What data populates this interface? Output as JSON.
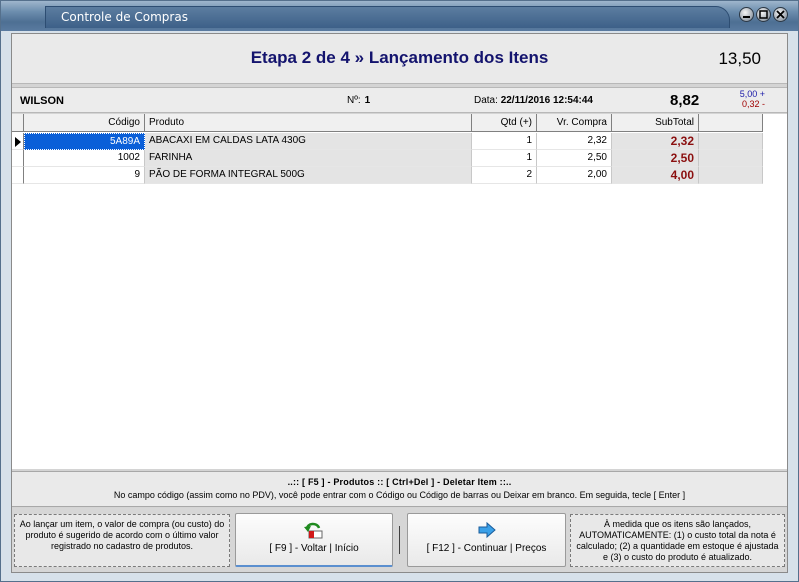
{
  "window": {
    "title": "Controle de Compras"
  },
  "header": {
    "step_title": "Etapa 2 de 4 » Lançamento dos Itens",
    "total": "13,50"
  },
  "info": {
    "supplier": "WILSON",
    "num_label": "Nº:",
    "num_value": "1",
    "date_label": "Data:",
    "date_value": "22/11/2016 12:54:44",
    "total": "8,82",
    "diff_plus": "5,00 +",
    "diff_minus": "0,32 -"
  },
  "grid": {
    "headers": {
      "codigo": "Código",
      "produto": "Produto",
      "qtd": "Qtd (+)",
      "vr_compra": "Vr. Compra",
      "subtotal": "SubTotal"
    },
    "rows": [
      {
        "codigo": "5A89A",
        "produto": "ABACAXI EM CALDAS LATA 430G",
        "qtd": "1",
        "vr_compra": "2,32",
        "subtotal": "2,32"
      },
      {
        "codigo": "1002",
        "produto": "FARINHA",
        "qtd": "1",
        "vr_compra": "2,50",
        "subtotal": "2,50"
      },
      {
        "codigo": "9",
        "produto": "PÃO DE FORMA INTEGRAL 500G",
        "qtd": "2",
        "vr_compra": "2,00",
        "subtotal": "4,00"
      }
    ]
  },
  "help": {
    "shortcuts": "..:: [ F5 ] - Produtos :: [ Ctrl+Del ] - Deletar Item ::..",
    "tip": "No campo código (assim como no PDV), você pode entrar com o Código ou Código de barras ou Deixar em branco. Em seguida, tecle [ Enter ]"
  },
  "footer": {
    "left_note": "Ao lançar um item, o valor de compra (ou custo) do produto é sugerido de acordo com o último valor registrado no cadastro de produtos.",
    "back_label": "[ F9 ] - Voltar | Início",
    "next_label": "[ F12 ] - Continuar | Preços",
    "right_note": "À medida que os itens são lançados, AUTOMATICAMENTE: (1) o custo total da nota é calculado; (2) a quantidade em estoque é ajustada e (3) o custo do produto é atualizado."
  },
  "colors": {
    "title_text": "#14146e",
    "subtotal": "#8b1010",
    "selected": "#0a5fd8"
  }
}
